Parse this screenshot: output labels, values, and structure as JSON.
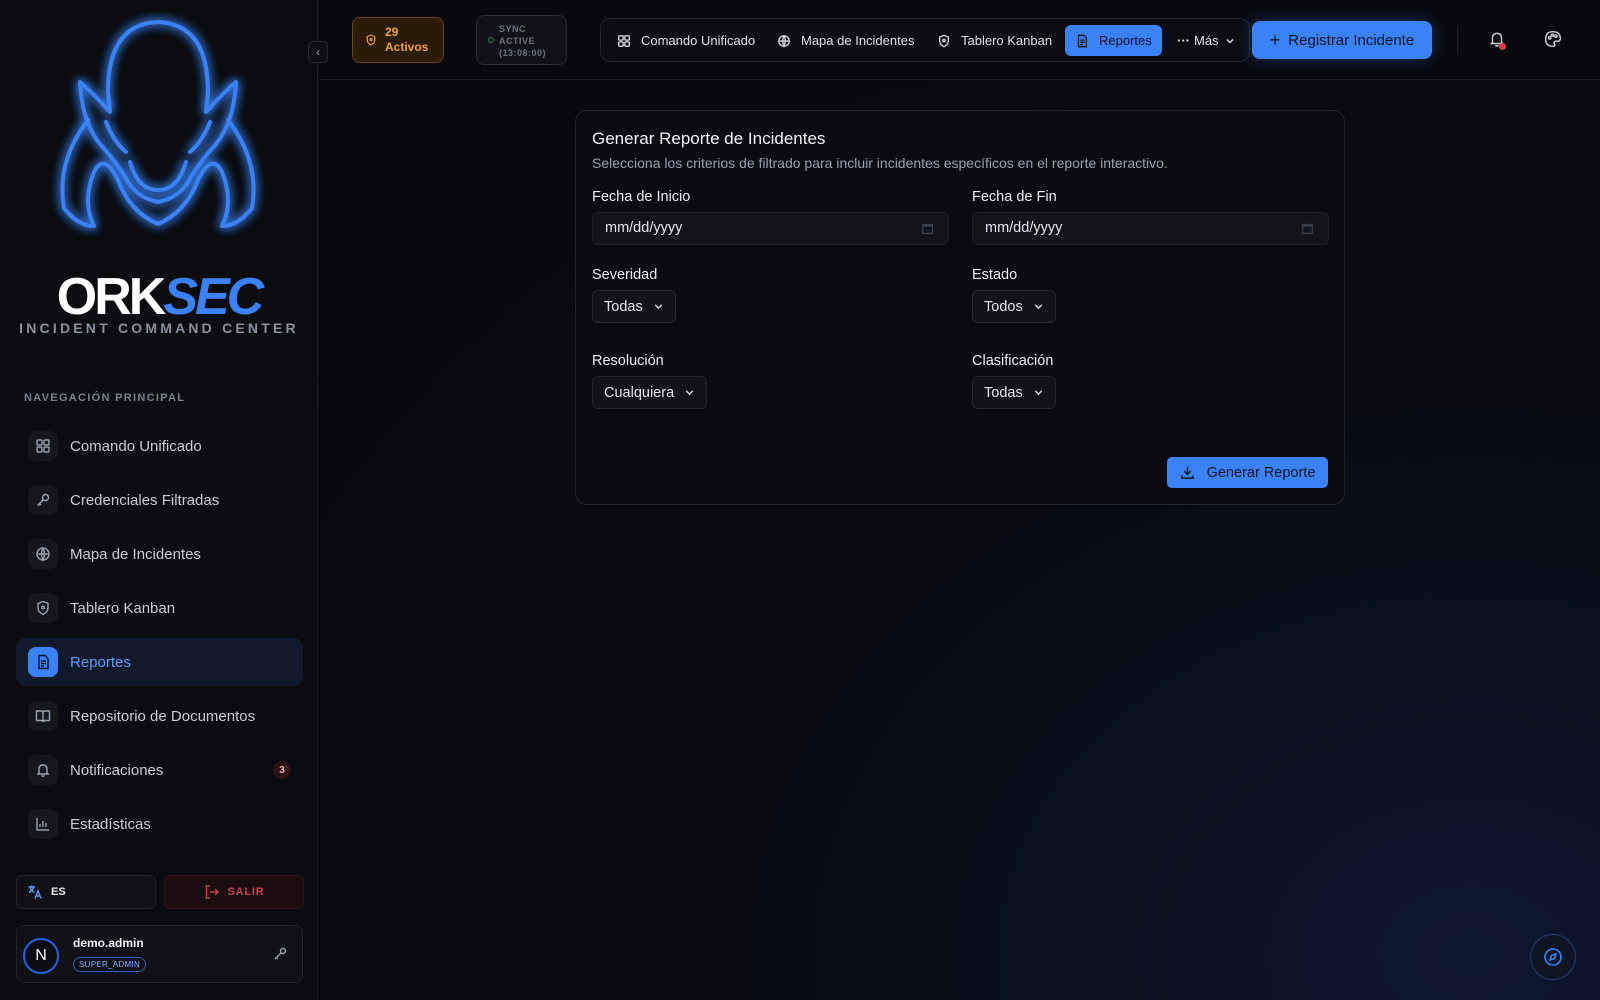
{
  "brand": {
    "name_part1": "ORK",
    "name_part2": "SEC",
    "subtitle": "INCIDENT COMMAND CENTER",
    "accent_color": "#3b82f6"
  },
  "sidebar": {
    "section_title": "NAVEGACIÓN PRINCIPAL",
    "items": [
      {
        "label": "Comando Unificado",
        "icon": "grid-icon"
      },
      {
        "label": "Credenciales Filtradas",
        "icon": "key-icon"
      },
      {
        "label": "Mapa de Incidentes",
        "icon": "globe-icon"
      },
      {
        "label": "Tablero Kanban",
        "icon": "shield-icon"
      },
      {
        "label": "Reportes",
        "icon": "file-text-icon",
        "active": true
      },
      {
        "label": "Repositorio de Documentos",
        "icon": "book-icon"
      },
      {
        "label": "Notificaciones",
        "icon": "bell-icon",
        "badge": "3"
      },
      {
        "label": "Estadísticas",
        "icon": "bar-chart-icon"
      }
    ],
    "language": "ES",
    "logout_label": "SALIR",
    "user": {
      "avatar_letter": "N",
      "name": "demo.admin",
      "role": "SUPER_ADMIN"
    }
  },
  "topbar": {
    "active_count": "29",
    "active_label": "Activos",
    "sync_line1": "SYNC",
    "sync_line2": "ACTIVE",
    "sync_time": "(13:08:00)",
    "nav": [
      {
        "label": "Comando Unificado",
        "icon": "grid-icon"
      },
      {
        "label": "Mapa de Incidentes",
        "icon": "globe-icon"
      },
      {
        "label": "Tablero Kanban",
        "icon": "shield-icon"
      },
      {
        "label": "Reportes",
        "icon": "file-text-icon",
        "active": true
      }
    ],
    "more_label": "Más",
    "register_label": "Registrar Incidente",
    "notification_dot_color": "#e5394b",
    "active_pill_color": "#f0a235"
  },
  "report": {
    "title": "Generar Reporte de Incidentes",
    "description": "Selecciona los criterios de filtrado para incluir incidentes específicos en el reporte interactivo.",
    "start_date_label": "Fecha de Inicio",
    "start_date_placeholder": "mm/dd/yyyy",
    "end_date_label": "Fecha de Fin",
    "end_date_placeholder": "mm/dd/yyyy",
    "severity_label": "Severidad",
    "severity_value": "Todas",
    "status_label": "Estado",
    "status_value": "Todos",
    "resolution_label": "Resolución",
    "resolution_value": "Cualquiera",
    "classification_label": "Clasificación",
    "classification_value": "Todas",
    "generate_label": "Generar Reporte"
  }
}
